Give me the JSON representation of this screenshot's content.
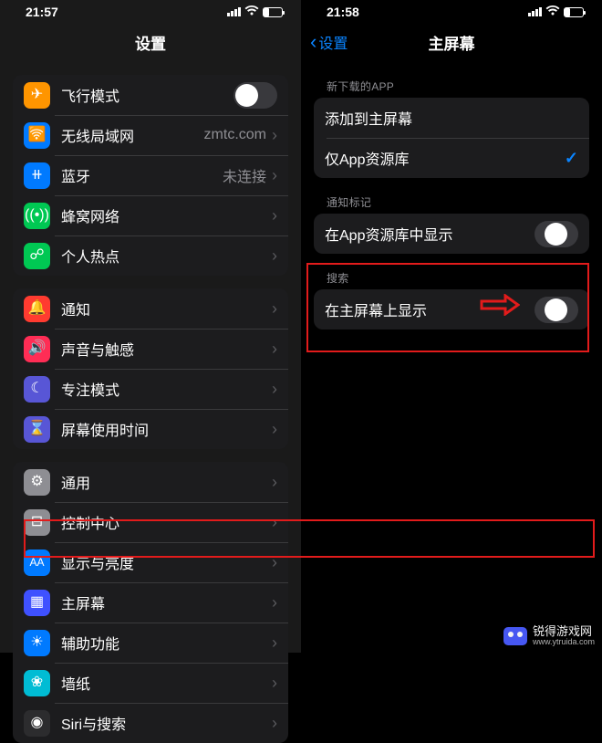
{
  "left": {
    "time": "21:57",
    "title": "设置",
    "rows": {
      "airplane": "飞行模式",
      "wifi": "无线局域网",
      "wifi_detail": "zmtc.com",
      "bt": "蓝牙",
      "bt_detail": "未连接",
      "cell": "蜂窝网络",
      "hotspot": "个人热点",
      "notif": "通知",
      "sound": "声音与触感",
      "focus": "专注模式",
      "st": "屏幕使用时间",
      "general": "通用",
      "control": "控制中心",
      "display": "显示与亮度",
      "home": "主屏幕",
      "access": "辅助功能",
      "wallpaper": "墙纸",
      "siri": "Siri与搜索"
    }
  },
  "right": {
    "time": "21:58",
    "back": "设置",
    "title": "主屏幕",
    "h1": "新下载的APP",
    "r1": "添加到主屏幕",
    "r2": "仅App资源库",
    "h2": "通知标记",
    "r3": "在App资源库中显示",
    "h3": "搜索",
    "r4": "在主屏幕上显示"
  },
  "watermark": {
    "title": "锐得游戏网",
    "url": "www.ytruida.com"
  }
}
